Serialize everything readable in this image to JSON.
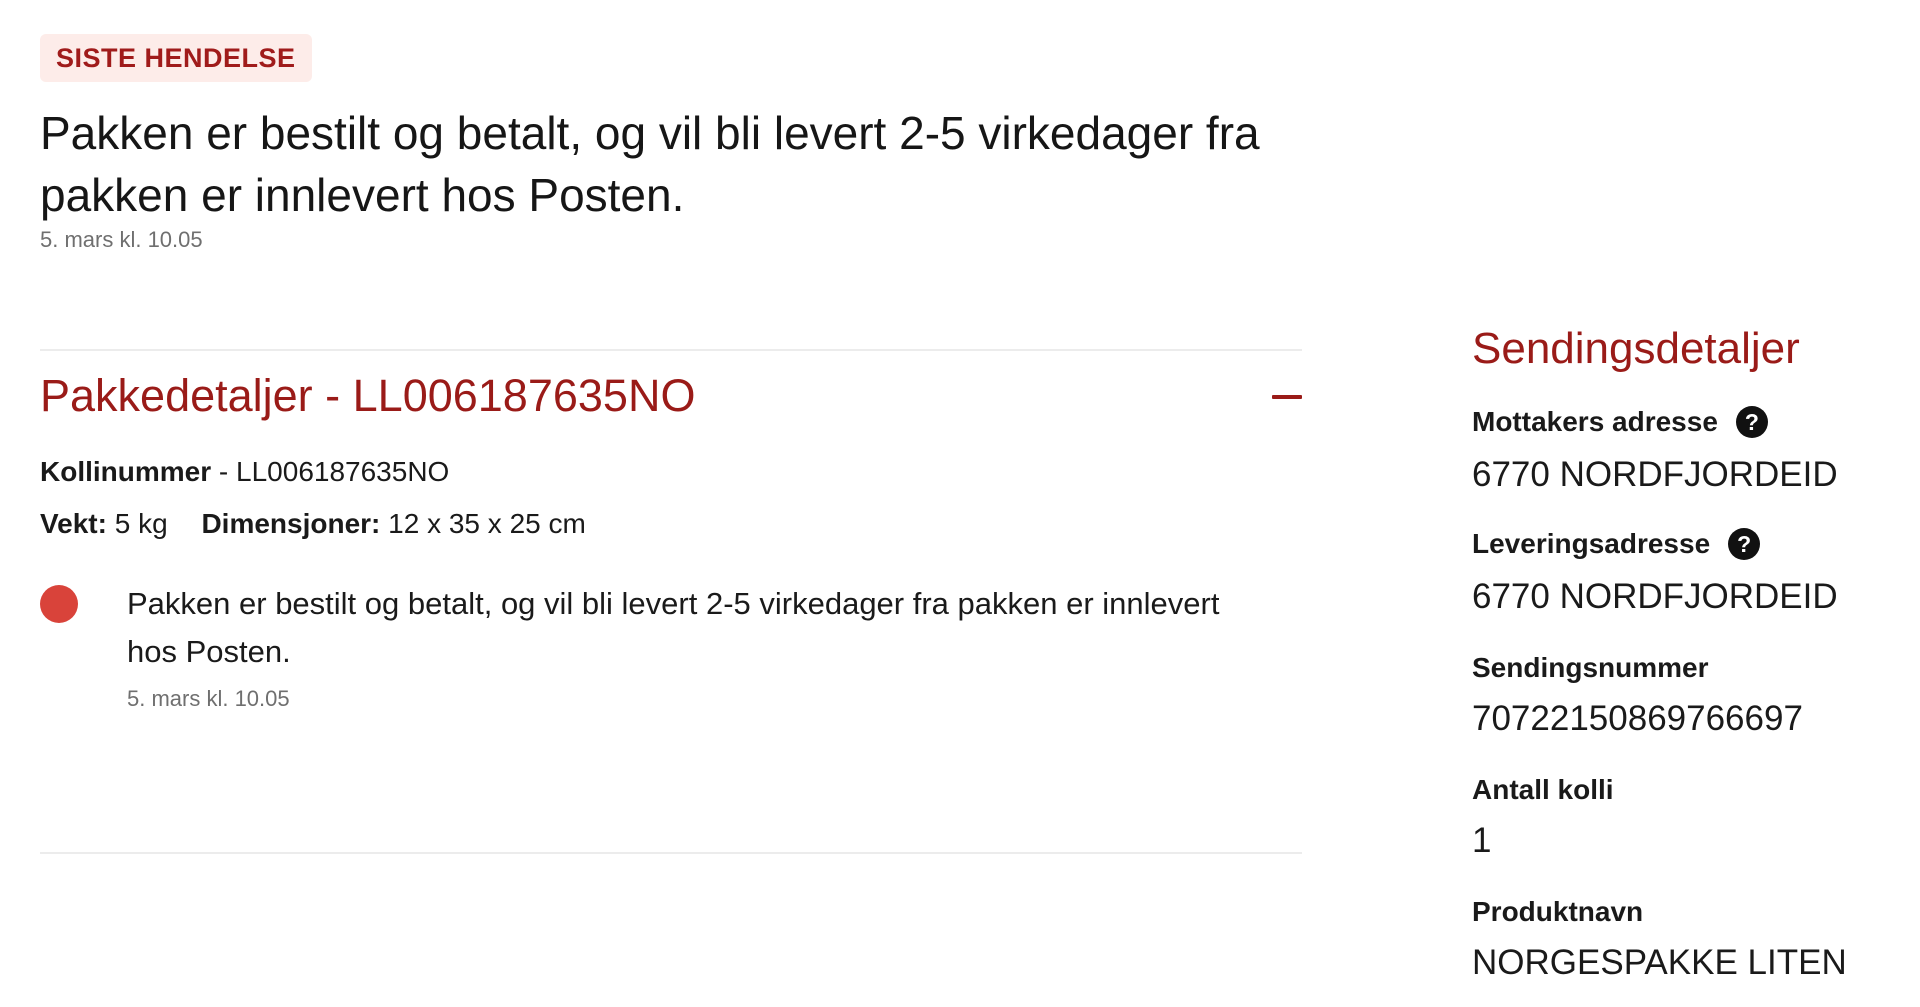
{
  "latest_event": {
    "badge": "SISTE HENDELSE",
    "headline": "Pakken er bestilt og betalt, og vil bli levert 2-5 virkedager fra pakken er innlevert hos Posten.",
    "time": "5. mars kl. 10.05"
  },
  "package_details": {
    "title": "Pakkedetaljer - LL006187635NO",
    "collapse_icon": "minus-icon",
    "colli_label": "Kollinummer",
    "colli_separator": " - ",
    "colli_value": "LL006187635NO",
    "weight_label": "Vekt:",
    "weight_value": "5 kg",
    "dimensions_label": "Dimensjoner:",
    "dimensions_value": "12 x 35 x 25 cm",
    "events": [
      {
        "text": "Pakken er bestilt og betalt, og vil bli levert 2-5 virkedager fra pakken er innlevert hos Posten.",
        "time": "5. mars kl. 10.05",
        "dot_color": "#d9433a"
      }
    ]
  },
  "shipment_details": {
    "title": "Sendingsdetaljer",
    "recipient_address_label": "Mottakers adresse",
    "recipient_address_value": "6770 NORDFJORDEID",
    "delivery_address_label": "Leveringsadresse",
    "delivery_address_value": "6770 NORDFJORDEID",
    "shipment_number_label": "Sendingsnummer",
    "shipment_number_value": "70722150869766697",
    "colli_count_label": "Antall kolli",
    "colli_count_value": "1",
    "product_name_label": "Produktnavn",
    "product_name_value": "NORGESPAKKE LITEN",
    "help_icon": "question-circle-icon"
  },
  "colors": {
    "brand_red": "#9a1b18",
    "badge_bg": "#fdece9",
    "status_dot": "#d9433a",
    "muted_text": "#6f6f6f"
  }
}
